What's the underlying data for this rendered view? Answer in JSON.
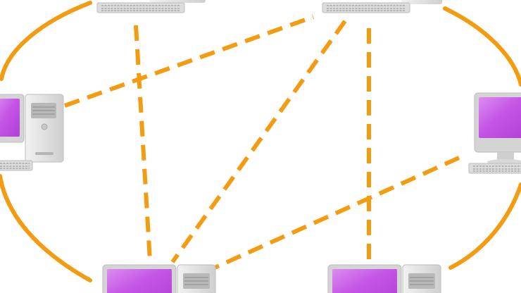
{
  "diagram": {
    "type": "mesh-network",
    "colors": {
      "link": "#f39c12",
      "screen": "#c455e6",
      "screen_highlight": "#dd8cf2",
      "case": "#e6e6e6",
      "case_shade": "#c9c9c9",
      "bezel": "#d4d4d4",
      "keyboard": "#dcdcdc",
      "keys": "#a9a9a9"
    },
    "nodes": [
      {
        "id": "top-left",
        "icon": "desktop-computer-icon"
      },
      {
        "id": "top-right",
        "icon": "desktop-computer-icon"
      },
      {
        "id": "left",
        "icon": "desktop-computer-icon"
      },
      {
        "id": "right",
        "icon": "desktop-computer-icon"
      },
      {
        "id": "bottom-left",
        "icon": "desktop-computer-icon"
      },
      {
        "id": "bottom-right",
        "icon": "desktop-computer-icon"
      }
    ],
    "links": [
      {
        "from": "top-left",
        "to": "bottom-left",
        "style": "dashed"
      },
      {
        "from": "left",
        "to": "top-right",
        "style": "dashed"
      },
      {
        "from": "top-right",
        "to": "bottom-left",
        "style": "dashed"
      },
      {
        "from": "top-right",
        "to": "bottom-right",
        "style": "dashed"
      },
      {
        "from": "right",
        "to": "bottom-left",
        "style": "dashed"
      },
      {
        "from": "ring",
        "to": "ring",
        "style": "solid-ring"
      }
    ]
  }
}
